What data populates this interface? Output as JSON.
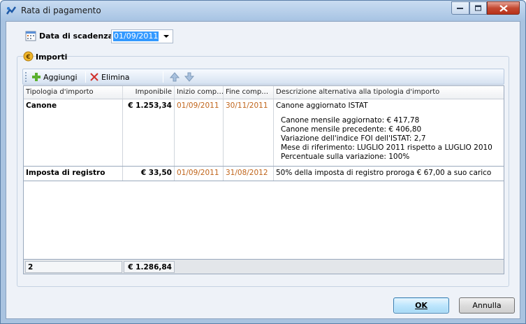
{
  "window": {
    "title": "Rata di pagamento",
    "icon": "app-icon"
  },
  "due": {
    "label": "Data di scadenza",
    "value": "01/09/2011",
    "icon": "calendar-icon"
  },
  "importi": {
    "title": "Importi",
    "icon": "euro-coin-icon",
    "toolbar": {
      "add_label": "Aggiungi",
      "delete_label": "Elimina"
    },
    "columns": [
      "Tipologia d'importo",
      "Imponibile",
      "Inizio comp…",
      "Fine comp…",
      "Descrizione alternativa alla tipologia d'importo"
    ],
    "rows": [
      {
        "tipologia": "Canone",
        "imponibile": "€ 1.253,34",
        "inizio": "01/09/2011",
        "fine": "30/11/2011",
        "descrizione": [
          "Canone aggiornato ISTAT",
          "",
          "Canone mensile aggiornato: € 417,78",
          "Canone mensile precedente: € 406,80",
          "Variazione dell'indice FOI dell'ISTAT: 2,7",
          "Mese di riferimento: LUGLIO 2011 rispetto a LUGLIO 2010",
          "Percentuale sulla variazione: 100%"
        ]
      },
      {
        "tipologia": "Imposta di registro",
        "imponibile": "€ 33,50",
        "inizio": "01/09/2011",
        "fine": "31/08/2012",
        "descrizione": [
          "50% della imposta di registro proroga € 67,00 a suo carico"
        ]
      }
    ],
    "footer": {
      "count": "2",
      "total": "€ 1.286,84"
    }
  },
  "buttons": {
    "ok": "OK",
    "cancel": "Annulla"
  },
  "colors": {
    "date_text": "#c0641a",
    "selection": "#3399ff"
  }
}
